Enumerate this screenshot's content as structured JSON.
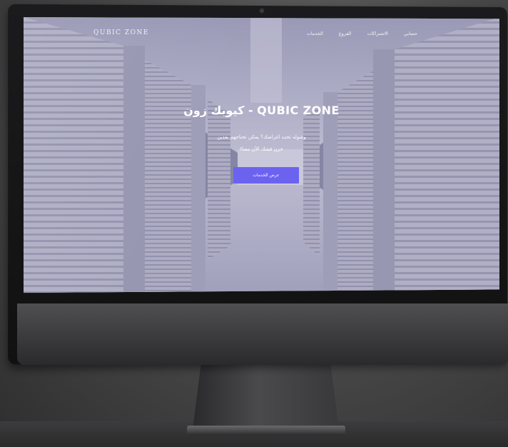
{
  "nav": {
    "brand": "QUBIC ZONE",
    "items": [
      {
        "label": "حسابي"
      },
      {
        "label": "الاشتراكات"
      },
      {
        "label": "الفروع"
      },
      {
        "label": "الخدمات"
      }
    ]
  },
  "hero": {
    "title": "كيوبك زون - QUBIC ZONE",
    "subtitle_line1": "وشوله تحت اغراضك؟ يمكن تحتاجهم بعدين",
    "subtitle_line2": "خزن فشك الآن معنا!",
    "cta_label": "عرض الخدمات"
  },
  "colors": {
    "accent": "#6c62f0",
    "overlay": "#7876a0"
  }
}
